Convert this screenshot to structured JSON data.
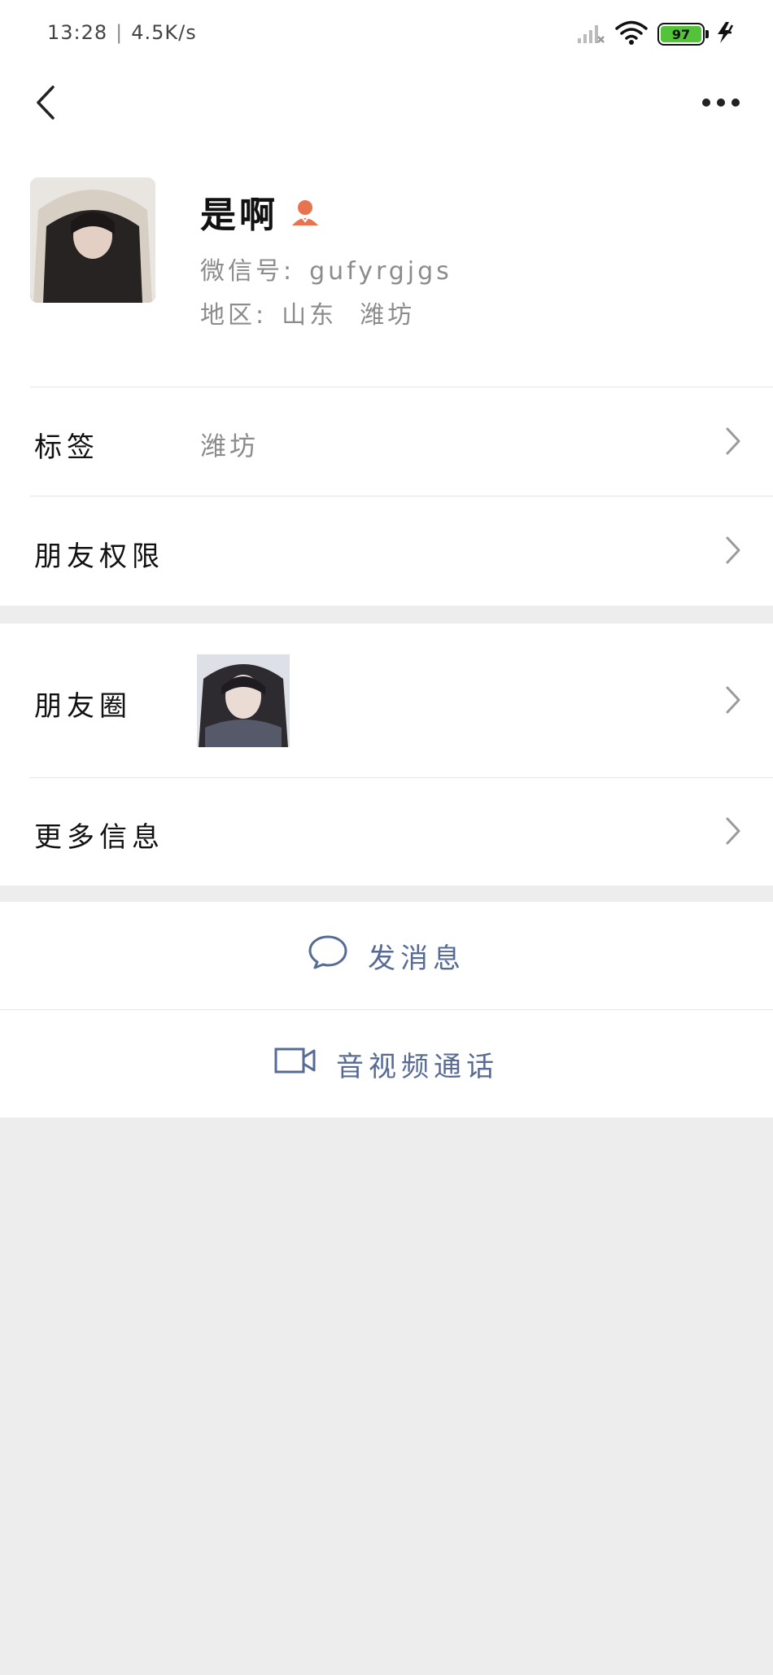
{
  "status_bar": {
    "time": "13:28",
    "speed": "4.5K/s",
    "battery": "97"
  },
  "profile": {
    "name": "是啊",
    "wechat_id_label": "微信号:",
    "wechat_id": "gufyrgjgs",
    "region_label": "地区:",
    "province": "山东",
    "city": "潍坊"
  },
  "rows": {
    "tags": {
      "label": "标签",
      "value": "潍坊"
    },
    "permissions": {
      "label": "朋友权限"
    },
    "moments": {
      "label": "朋友圈"
    },
    "more_info": {
      "label": "更多信息"
    }
  },
  "actions": {
    "message": "发消息",
    "call": "音视频通话"
  },
  "colors": {
    "link_blue": "#576b95",
    "vip_orange": "#e8734f",
    "background": "#ededed"
  }
}
